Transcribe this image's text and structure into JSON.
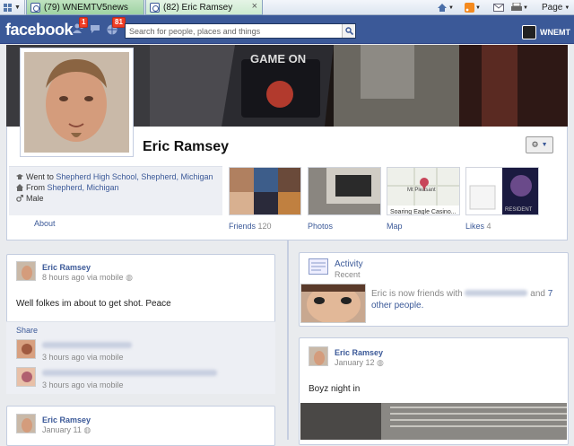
{
  "browser": {
    "tabs": [
      {
        "label": "(79) WNEMTV5news",
        "active": false
      },
      {
        "label": "(82) Eric Ramsey",
        "active": true
      }
    ],
    "close_glyph": "×",
    "page_menu": "Page"
  },
  "header": {
    "logo": "facebook",
    "badges": {
      "friend_requests": "1",
      "notifications": "81"
    },
    "search_placeholder": "Search for people, places and things",
    "user_label": "WNEMT"
  },
  "profile": {
    "name": "Eric Ramsey",
    "info": [
      {
        "prefix": "Went to ",
        "link": "Shepherd High School, Shepherd, Michigan"
      },
      {
        "prefix": "From ",
        "link": "Shepherd, Michigan"
      },
      {
        "prefix": "",
        "link": "",
        "text": "Male"
      }
    ],
    "about_label": "About"
  },
  "apps": [
    {
      "label": "Friends",
      "count": "120"
    },
    {
      "label": "Photos",
      "count": ""
    },
    {
      "label": "Map",
      "count": ""
    },
    {
      "label": "Likes",
      "count": "4"
    }
  ],
  "map_texts": {
    "place": "Mt Pleasant",
    "caption": "Soaring Eagle Casino..."
  },
  "cover_text": "GAME ON",
  "likes_thumb_text": "RESIDENT",
  "posts": [
    {
      "author": "Eric Ramsey",
      "time": "8 hours ago via mobile",
      "text": "Well folkes im about to get shot. Peace"
    },
    {
      "author": "Eric Ramsey",
      "time": "January 11"
    }
  ],
  "share": {
    "label": "Share",
    "items": [
      {
        "time": "3 hours ago via mobile"
      },
      {
        "time": "3 hours ago via mobile"
      }
    ]
  },
  "activity": {
    "title": "Activity",
    "subtitle": "Recent",
    "text_prefix": "Eric is now friends with",
    "text_and": "and",
    "text_count": "7",
    "text_link": "other people."
  },
  "right_post": {
    "author": "Eric Ramsey",
    "time": "January 12",
    "text": "Boyz night in"
  },
  "colors": {
    "facebook_blue": "#3b5998",
    "badge_red": "#f03d25",
    "link": "#3b5998"
  }
}
